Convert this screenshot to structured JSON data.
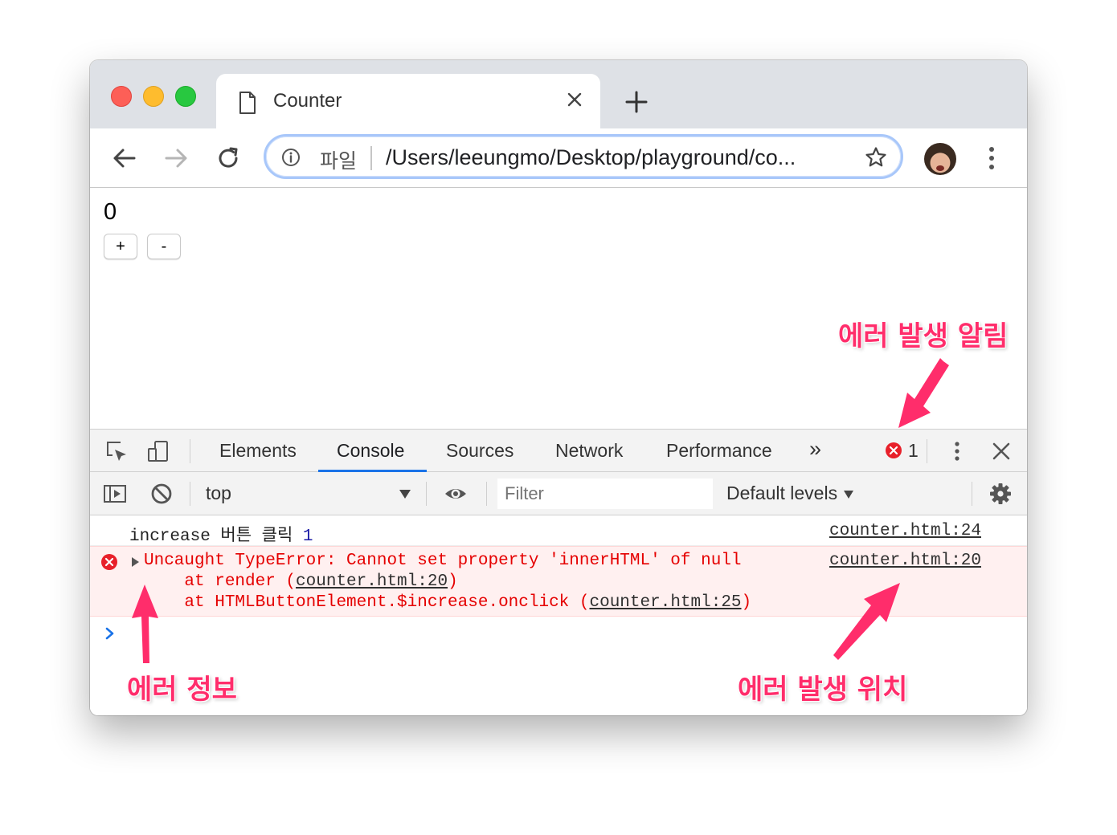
{
  "browser": {
    "tab_title": "Counter",
    "url_scheme_label": "파일",
    "url": "/Users/leeungmo/Desktop/playground/co..."
  },
  "page": {
    "counter_value": "0",
    "increase_label": "+",
    "decrease_label": "-"
  },
  "devtools": {
    "tabs": [
      "Elements",
      "Console",
      "Sources",
      "Network",
      "Performance"
    ],
    "active_tab": "Console",
    "more_tabs_glyph": "»",
    "error_count": "1",
    "context": "top",
    "filter_placeholder": "Filter",
    "levels_label": "Default levels"
  },
  "console": {
    "log": {
      "text": "increase 버튼 클릭 ",
      "number": "1",
      "source": "counter.html:24"
    },
    "error": {
      "message": "Uncaught TypeError: Cannot set property 'innerHTML' of null",
      "stack1_prefix": "    at render (",
      "stack1_link": "counter.html:20",
      "stack1_suffix": ")",
      "stack2_prefix": "    at HTMLButtonElement.$increase.onclick (",
      "stack2_link": "counter.html:25",
      "stack2_suffix": ")",
      "source": "counter.html:20"
    },
    "prompt_glyph": "›"
  },
  "annotations": {
    "error_alert": "에러 발생 알림",
    "error_info": "에러 정보",
    "error_location": "에러 발생 위치",
    "color": "#ff2d6b"
  }
}
